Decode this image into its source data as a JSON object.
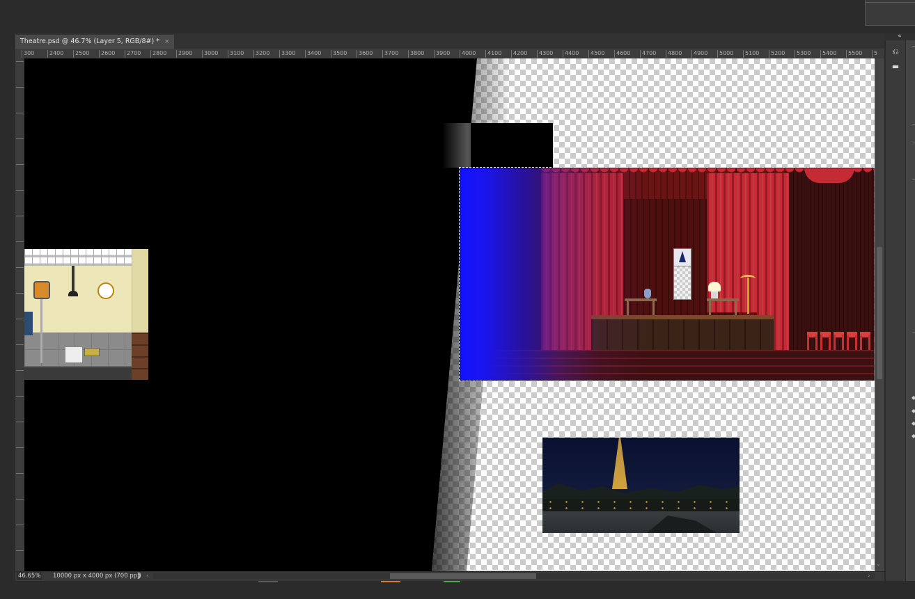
{
  "document": {
    "tab_title": "Theatre.psd @ 46.7% (Layer 5, RGB/8#) *",
    "close_glyph": "×"
  },
  "ruler": {
    "horizontal_ticks": [
      "300",
      "2400",
      "2500",
      "2600",
      "2700",
      "2800",
      "2900",
      "3000",
      "3100",
      "3200",
      "3300",
      "3400",
      "3500",
      "3600",
      "3700",
      "3800",
      "3900",
      "4000",
      "4100",
      "4200",
      "4300",
      "4400",
      "4500",
      "4600",
      "4700",
      "4800",
      "4900",
      "5000",
      "5100",
      "5200",
      "5300",
      "5400",
      "5500",
      "5"
    ]
  },
  "status": {
    "zoom": "46.65%",
    "doc_info": "10000 px x 4000 px (700 ppi)",
    "arrow_glyph": "❯",
    "scroll_left_glyph": "‹",
    "scroll_right_glyph": "›",
    "scroll_down_glyph": "⌄"
  },
  "panel": {
    "collapse_glyph": "«",
    "history_icon": "⎌",
    "comments_icon": "▬"
  },
  "accent_colors": {
    "selection_border": "#ffffff",
    "mark_orange": "#d77a2b",
    "mark_green": "#4aa84a"
  }
}
